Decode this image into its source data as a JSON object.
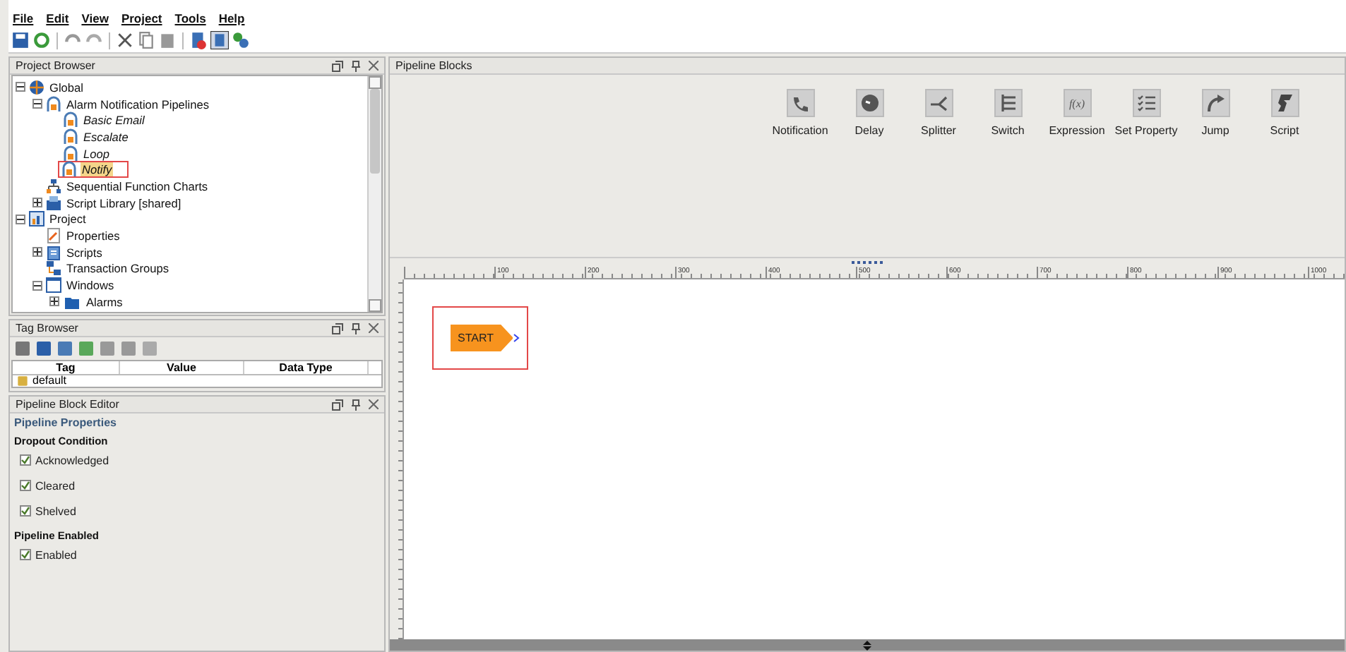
{
  "menu": [
    "File",
    "Edit",
    "View",
    "Project",
    "Tools",
    "Help"
  ],
  "project_browser": {
    "title": "Project Browser",
    "tree": [
      {
        "label": "Global",
        "kind": "global",
        "expanded": true,
        "selected": false,
        "children": [
          {
            "label": "Alarm Notification Pipelines",
            "kind": "pipelines",
            "expanded": true,
            "selected": false,
            "children": [
              {
                "label": "Basic Email",
                "kind": "pipeline",
                "selected": false
              },
              {
                "label": "Escalate",
                "kind": "pipeline",
                "selected": false
              },
              {
                "label": "Loop",
                "kind": "pipeline",
                "selected": false
              },
              {
                "label": "Notify",
                "kind": "pipeline",
                "selected": true
              }
            ]
          },
          {
            "label": "Sequential Function Charts",
            "kind": "sfc",
            "selected": false
          },
          {
            "label": "Script Library [shared]",
            "kind": "library",
            "expanded": false,
            "selected": false
          }
        ]
      },
      {
        "label": "Project",
        "kind": "project",
        "expanded": true,
        "selected": false,
        "children": [
          {
            "label": "Properties",
            "kind": "properties",
            "selected": false
          },
          {
            "label": "Scripts",
            "kind": "scripts",
            "expanded": false,
            "selected": false
          },
          {
            "label": "Transaction Groups",
            "kind": "groups",
            "selected": false
          },
          {
            "label": "Windows",
            "kind": "windows",
            "expanded": true,
            "selected": false,
            "children": [
              {
                "label": "Alarms",
                "kind": "folder",
                "expanded": false,
                "selected": false
              }
            ]
          }
        ]
      }
    ]
  },
  "tag_browser": {
    "title": "Tag Browser",
    "columns": [
      "Tag",
      "Value",
      "Data Type"
    ],
    "rows": [
      {
        "tag": "default"
      }
    ]
  },
  "block_editor": {
    "title": "Pipeline Block Editor",
    "section": "Pipeline Properties",
    "groups": [
      {
        "title": "Dropout Condition",
        "options": [
          {
            "label": "Acknowledged",
            "checked": true
          },
          {
            "label": "Cleared",
            "checked": true
          },
          {
            "label": "Shelved",
            "checked": true
          }
        ]
      },
      {
        "title": "Pipeline Enabled",
        "options": [
          {
            "label": "Enabled",
            "checked": true
          }
        ]
      }
    ]
  },
  "pipeline_blocks": {
    "title": "Pipeline Blocks",
    "blocks": [
      {
        "label": "Notification",
        "kind": "notification"
      },
      {
        "label": "Delay",
        "kind": "delay"
      },
      {
        "label": "Splitter",
        "kind": "splitter"
      },
      {
        "label": "Switch",
        "kind": "switch"
      },
      {
        "label": "Expression",
        "kind": "expression",
        "glyph": "f(x)"
      },
      {
        "label": "Set Property",
        "kind": "setproperty"
      },
      {
        "label": "Jump",
        "kind": "jump"
      },
      {
        "label": "Script",
        "kind": "script"
      }
    ]
  },
  "canvas": {
    "ruler_labels": [
      "100",
      "200",
      "300",
      "400",
      "500",
      "600",
      "700",
      "800",
      "900",
      "1000"
    ],
    "start_node": {
      "label": "START",
      "highlighted": true
    }
  }
}
